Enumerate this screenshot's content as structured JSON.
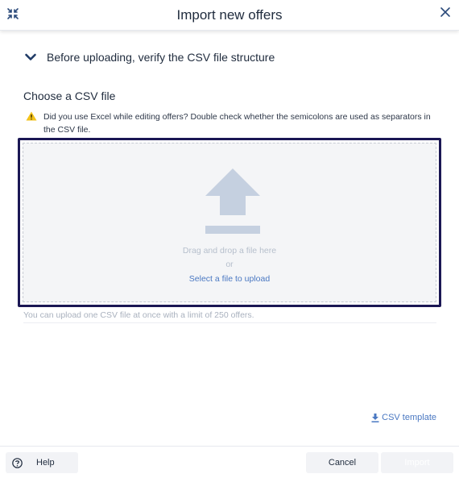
{
  "dialog": {
    "title": "Import new offers"
  },
  "accordion": {
    "label": "Before uploading, verify the CSV file structure",
    "expanded": false
  },
  "section": {
    "title": "Choose a CSV file"
  },
  "warning": {
    "text": "Did you use Excel while editing offers? Double check whether the semicolons are used as separators in the CSV file.",
    "color": "#f2c21b"
  },
  "dropzone": {
    "drag_text": "Drag and drop a file here",
    "or_text": "or",
    "select_link": "Select a file to upload",
    "border_color": "#1b1754",
    "icon_color": "#c5d0e0"
  },
  "limit_note": "You can upload one CSV file at once with a limit of 250 offers.",
  "csv_template": {
    "label": "CSV template"
  },
  "footer": {
    "help_label": "Help",
    "cancel_label": "Cancel",
    "import_label": "Import",
    "import_enabled": false
  },
  "colors": {
    "link": "#4a78c2",
    "text": "#1f2b3d"
  }
}
